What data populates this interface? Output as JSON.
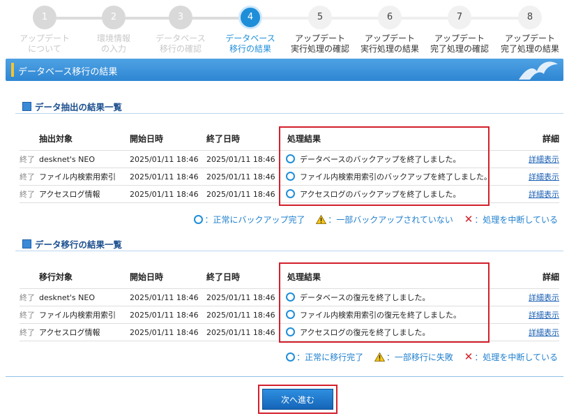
{
  "stepper": [
    {
      "num": "1",
      "line1": "アップデート",
      "line2": "について",
      "state": "done"
    },
    {
      "num": "2",
      "line1": "環境情報",
      "line2": "の入力",
      "state": "done"
    },
    {
      "num": "3",
      "line1": "データベース",
      "line2": "移行の確認",
      "state": "done"
    },
    {
      "num": "4",
      "line1": "データベース",
      "line2": "移行の結果",
      "state": "current"
    },
    {
      "num": "5",
      "line1": "アップデート",
      "line2": "実行処理の確認",
      "state": "todo"
    },
    {
      "num": "6",
      "line1": "アップデート",
      "line2": "実行処理の結果",
      "state": "todo"
    },
    {
      "num": "7",
      "line1": "アップデート",
      "line2": "完了処理の確認",
      "state": "todo"
    },
    {
      "num": "8",
      "line1": "アップデート",
      "line2": "完了処理の結果",
      "state": "todo"
    }
  ],
  "header": {
    "title": "データベース移行の結果"
  },
  "extract": {
    "title": "データ抽出の結果一覧",
    "columns": {
      "target": "抽出対象",
      "start": "開始日時",
      "end": "終了日時",
      "result": "処理結果",
      "detail": "詳細"
    },
    "rows": [
      {
        "status": "終了",
        "target": "desknet's NEO",
        "start": "2025/01/11 18:46",
        "end": "2025/01/11 18:46",
        "result": "データベースのバックアップを終了しました。",
        "detail": "詳細表示"
      },
      {
        "status": "終了",
        "target": "ファイル内検索用索引",
        "start": "2025/01/11 18:46",
        "end": "2025/01/11 18:46",
        "result": "ファイル内検索用索引のバックアップを終了しました。",
        "detail": "詳細表示"
      },
      {
        "status": "終了",
        "target": "アクセスログ情報",
        "start": "2025/01/11 18:46",
        "end": "2025/01/11 18:46",
        "result": "アクセスログのバックアップを終了しました。",
        "detail": "詳細表示"
      }
    ],
    "legend": {
      "ok": "：正常にバックアップ完了",
      "partial": "：一部バックアップされていない",
      "stopped": "：処理を中断している"
    }
  },
  "migrate": {
    "title": "データ移行の結果一覧",
    "columns": {
      "target": "移行対象",
      "start": "開始日時",
      "end": "終了日時",
      "result": "処理結果",
      "detail": "詳細"
    },
    "rows": [
      {
        "status": "終了",
        "target": "desknet's NEO",
        "start": "2025/01/11 18:46",
        "end": "2025/01/11 18:46",
        "result": "データベースの復元を終了しました。",
        "detail": "詳細表示"
      },
      {
        "status": "終了",
        "target": "ファイル内検索用索引",
        "start": "2025/01/11 18:46",
        "end": "2025/01/11 18:46",
        "result": "ファイル内検索用索引の復元を終了しました。",
        "detail": "詳細表示"
      },
      {
        "status": "終了",
        "target": "アクセスログ情報",
        "start": "2025/01/11 18:46",
        "end": "2025/01/11 18:46",
        "result": "アクセスログの復元を終了しました。",
        "detail": "詳細表示"
      }
    ],
    "legend": {
      "ok": "：正常に移行完了",
      "partial": "：一部移行に失敗",
      "stopped": "：処理を中断している"
    }
  },
  "footer": {
    "next_label": "次へ進む"
  },
  "colors": {
    "accent": "#1f8ed9",
    "highlight_border": "#d31f2b",
    "header_bar": "#3a8fd8",
    "warning": "#f5c518",
    "error": "#d3202a"
  }
}
